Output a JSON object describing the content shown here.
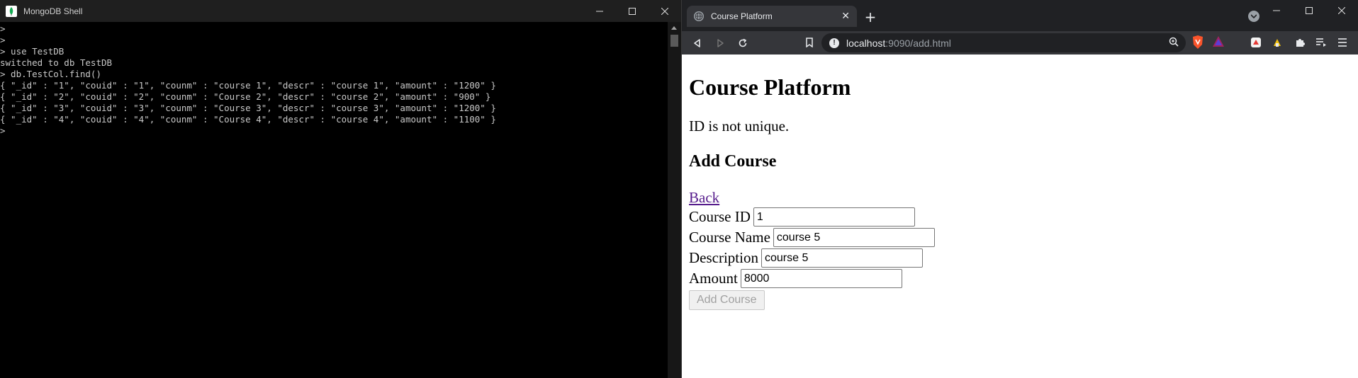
{
  "terminal": {
    "title": "MongoDB Shell",
    "lines": [
      ">",
      ">",
      "> use TestDB",
      "switched to db TestDB",
      "> db.TestCol.find()",
      "{ \"_id\" : \"1\", \"couid\" : \"1\", \"counm\" : \"course 1\", \"descr\" : \"course 1\", \"amount\" : \"1200\" }",
      "{ \"_id\" : \"2\", \"couid\" : \"2\", \"counm\" : \"Course 2\", \"descr\" : \"course 2\", \"amount\" : \"900\" }",
      "{ \"_id\" : \"3\", \"couid\" : \"3\", \"counm\" : \"Course 3\", \"descr\" : \"course 3\", \"amount\" : \"1200\" }",
      "{ \"_id\" : \"4\", \"couid\" : \"4\", \"counm\" : \"Course 4\", \"descr\" : \"course 4\", \"amount\" : \"1100\" }",
      ">"
    ]
  },
  "browser": {
    "tab_title": "Course Platform",
    "url_host": "localhost",
    "url_rest": ":9090/add.html"
  },
  "page": {
    "heading": "Course Platform",
    "message": "ID is not unique.",
    "subheading": "Add Course",
    "back_link": "Back",
    "fields": {
      "course_id": {
        "label": "Course ID",
        "value": "1"
      },
      "course_name": {
        "label": "Course Name",
        "value": "course 5"
      },
      "description": {
        "label": "Description",
        "value": "course 5"
      },
      "amount": {
        "label": "Amount",
        "value": "8000"
      }
    },
    "submit_label": "Add Course"
  },
  "colors": {
    "terminal_bg": "#000000",
    "terminal_text": "#c8c8c8",
    "browser_chrome": "#35363a",
    "tabstrip": "#202124",
    "visited_link": "#551a8b"
  },
  "icons": [
    "mongodb-leaf-icon",
    "minimize-icon",
    "maximize-icon",
    "close-icon",
    "globe-icon",
    "plus-icon",
    "tab-search-icon",
    "back-icon",
    "forward-icon",
    "reload-icon",
    "bookmark-icon",
    "info-icon",
    "zoom-icon",
    "brave-shields-icon",
    "brave-rewards-icon",
    "extension-icon",
    "puzzle-icon",
    "playlist-icon",
    "menu-icon"
  ]
}
